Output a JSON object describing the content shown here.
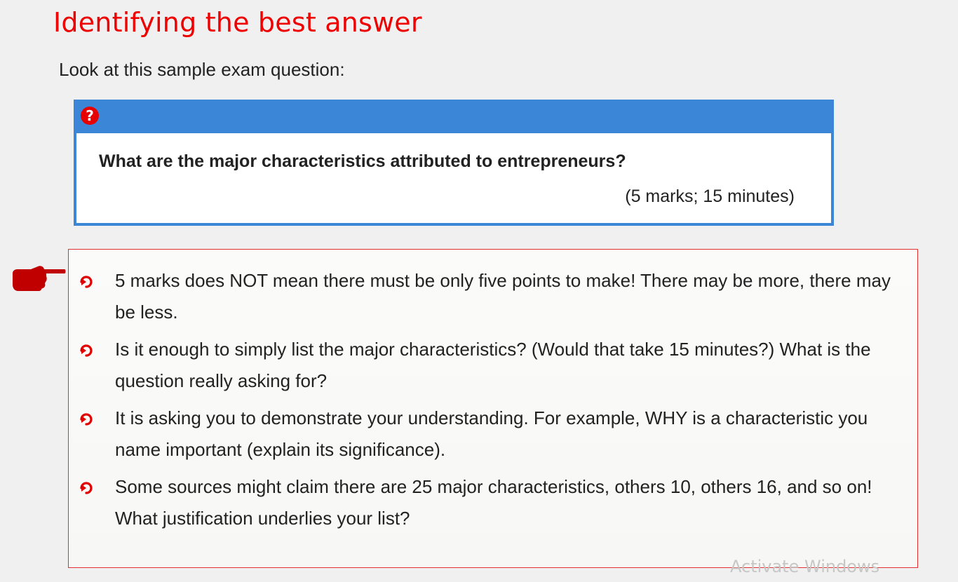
{
  "slide": {
    "title": "Identifying the best answer",
    "intro": "Look at this sample exam question:",
    "question": {
      "icon": "question-mark-icon",
      "text": "What are the major characteristics attributed to entrepreneurs?",
      "marks": "(5 marks; 15 minutes)"
    },
    "pointer_icon": "pointing-hand-icon",
    "bullet_icon": "curved-arrow-bullet-icon",
    "points": [
      "5 marks does NOT mean there must be only five points to make! There may be more, there may be less.",
      "Is it enough to simply list the major characteristics? (Would that take 15 minutes?) What is the question really asking for?",
      "It is asking you to demonstrate your understanding. For example, WHY is a characteristic you name important (explain its significance).",
      "Some sources might claim there are 25 major characteristics, others 10, others 16, and so on! What justification underlies your list?"
    ]
  },
  "watermark": "Activate Windows",
  "colors": {
    "title": "#ee0000",
    "question_border": "#3b86d6",
    "tips_border": "#e03030",
    "bullet": "#e00000",
    "pointer": "#c00000",
    "background": "#f0f0f0"
  }
}
